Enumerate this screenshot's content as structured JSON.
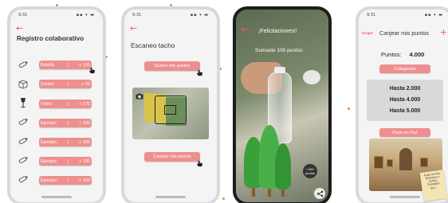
{
  "status": {
    "time": "9:31",
    "icons": "▪▪ ▾ ▬"
  },
  "flow_colors": {
    "accent": "#ee8f8f",
    "arrow": "#e85a5a",
    "dot": "#f08a3a"
  },
  "screen1": {
    "title": "Registro colaborativo",
    "rows": [
      {
        "label": "Botella",
        "sep": "|",
        "points": "+ 100",
        "icon": "bottle-icon"
      },
      {
        "label": "Cartón",
        "sep": "|",
        "points": "+ 25",
        "icon": "box-icon"
      },
      {
        "label": "Vidrio",
        "sep": "|",
        "points": "+ 170",
        "icon": "wine-glass-icon"
      },
      {
        "label": "Ejemplo",
        "sep": "|",
        "points": "+ 100",
        "icon": "bottle-icon"
      },
      {
        "label": "Ejemplo",
        "sep": "|",
        "points": "+ 100",
        "icon": "bottle-icon"
      },
      {
        "label": "Ejemplo",
        "sep": "|",
        "points": "+ 100",
        "icon": "bottle-icon"
      },
      {
        "label": "Ejemplo",
        "sep": "|",
        "points": "+ 100",
        "icon": "bottle-icon"
      }
    ]
  },
  "screen2": {
    "title": "Escaneo tacho",
    "quiero_button": "Quiero mis puntos",
    "canjear_button": "Canjear mis puntos"
  },
  "screen3": {
    "congrats": "¡Felicitaciones!!",
    "sumaste": "Sumaste 100 puntos",
    "badge": "+100 puntos"
  },
  "screen4": {
    "brand": "Grupo",
    "title": "Canjear mis puntos",
    "points_label": "Puntos:",
    "points_value": "4.000",
    "categorias_button": "Categorías",
    "tiers": [
      "Hasta 2.000",
      "Hasta 4.000",
      "Hasta 5.000"
    ],
    "pase_button": "Pase en Paz",
    "note_lines": [
      "Pase en Paz",
      "Entradas a museo",
      "Zoologico",
      "Etc..."
    ]
  }
}
